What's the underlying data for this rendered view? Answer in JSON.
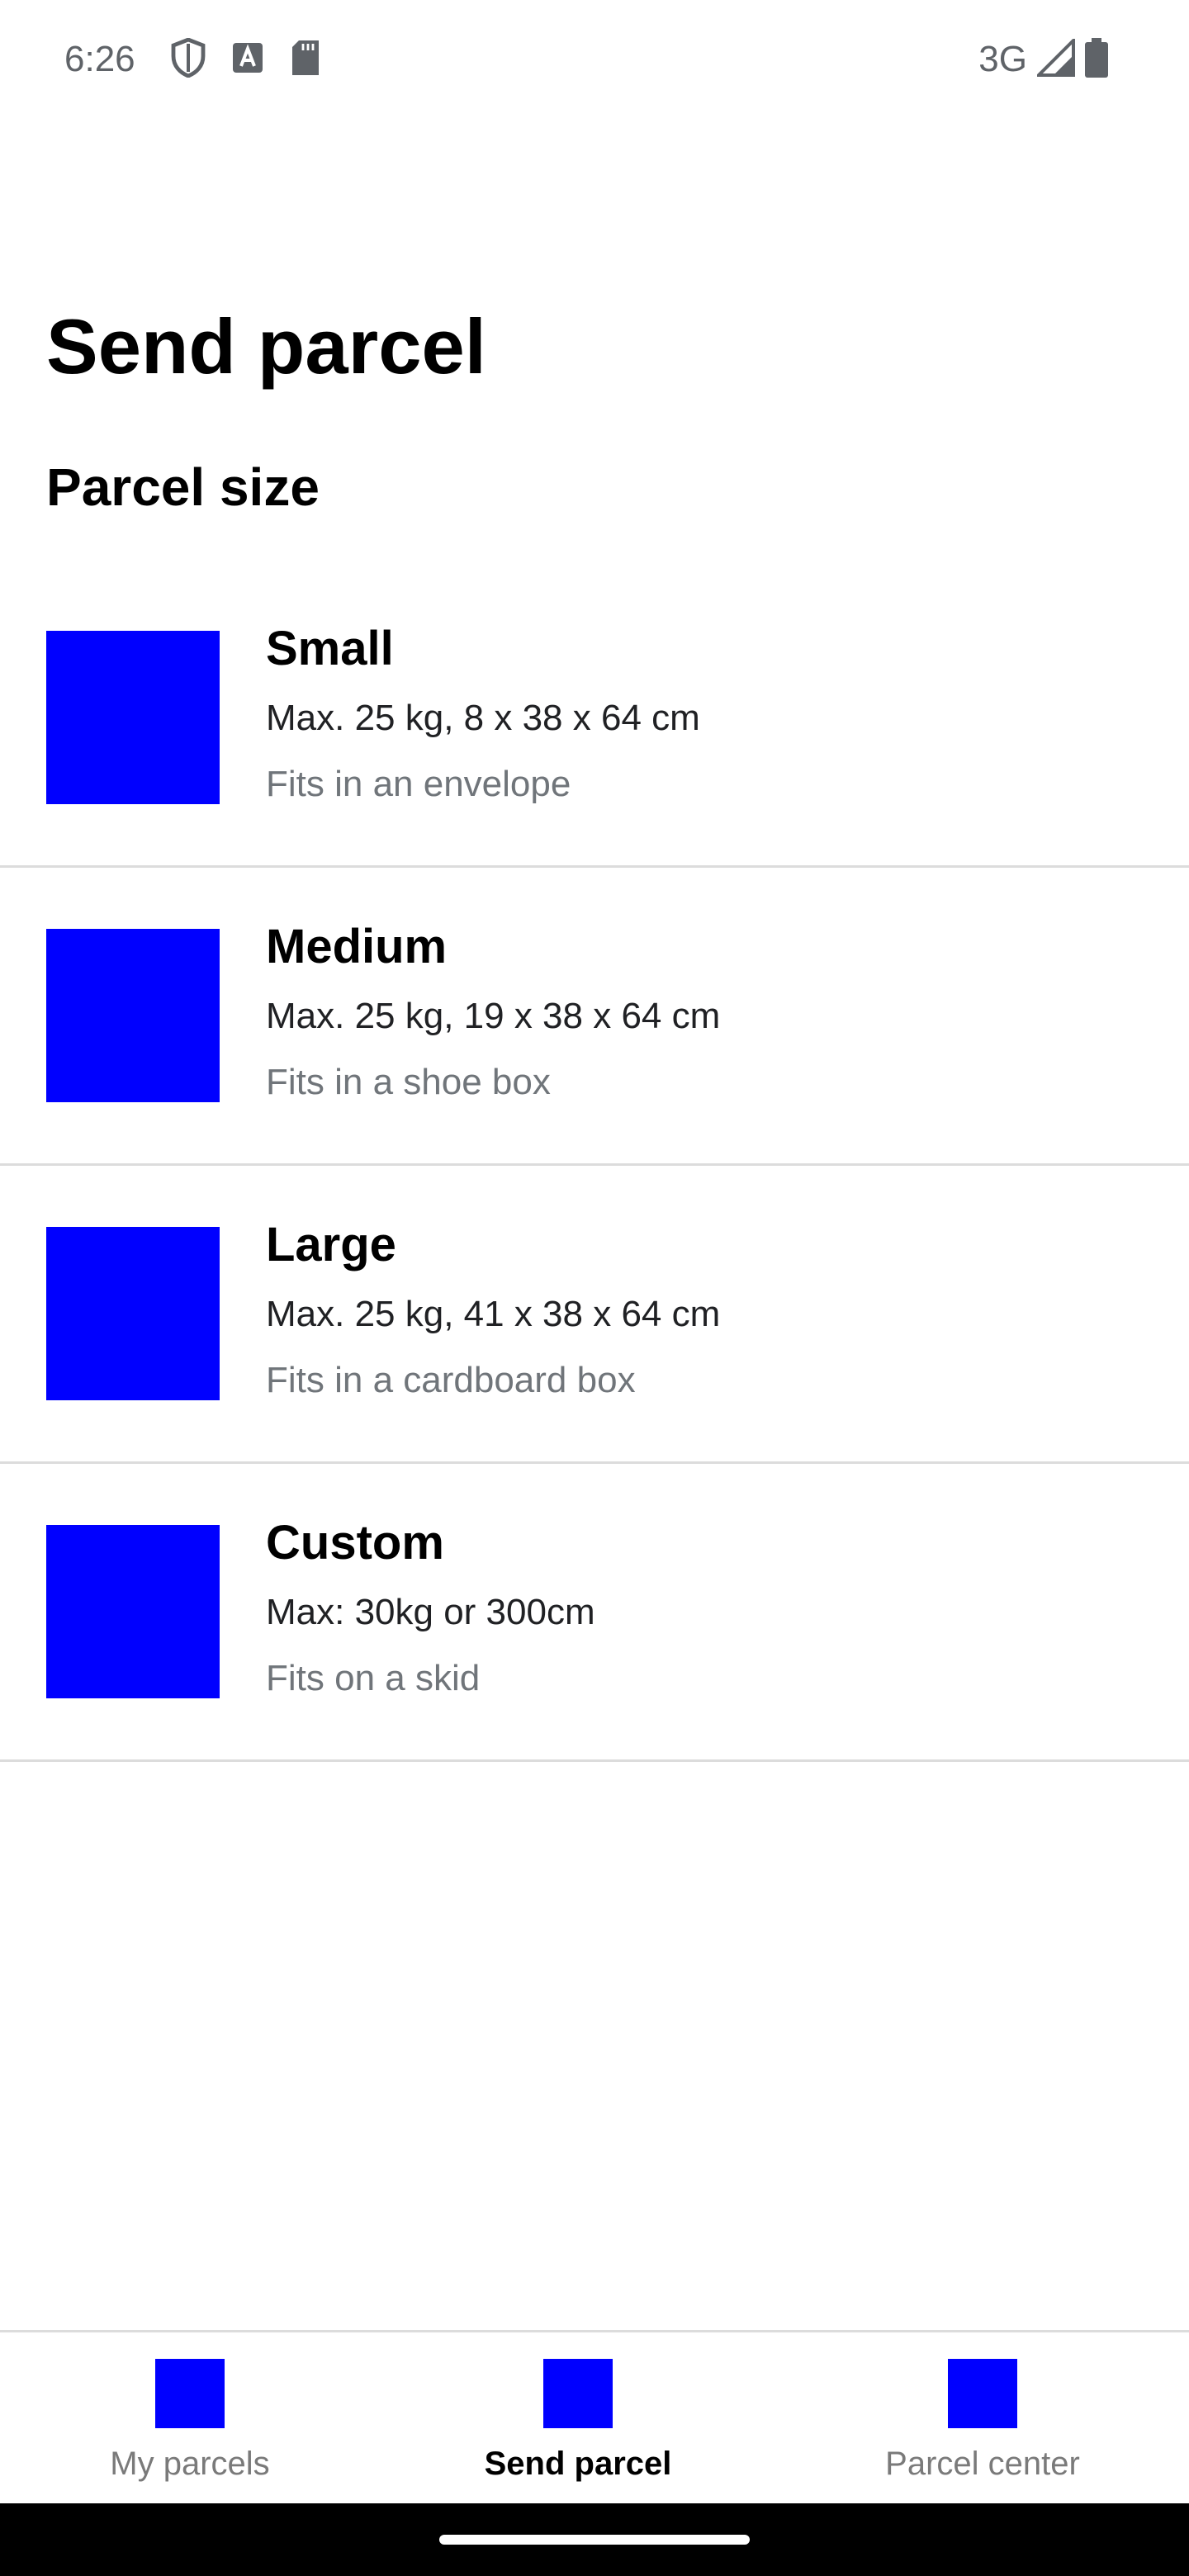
{
  "status_bar": {
    "time": "6:26",
    "network": "3G",
    "icons": [
      "shield-icon",
      "font-a-icon",
      "sd-card-icon",
      "signal-icon",
      "battery-icon"
    ]
  },
  "page": {
    "title": "Send parcel",
    "section_title": "Parcel size"
  },
  "colors": {
    "thumbnail": "#0000ff",
    "divider": "#dcdcdc",
    "secondary_text": "#70757a",
    "inactive_nav": "#7a7a7a"
  },
  "parcels": [
    {
      "name": "Small",
      "dims": "Max. 25 kg, 8 x 38 x 64 cm",
      "desc": "Fits in an envelope"
    },
    {
      "name": "Medium",
      "dims": "Max. 25 kg, 19 x 38 x 64 cm",
      "desc": "Fits in a shoe box"
    },
    {
      "name": "Large",
      "dims": "Max. 25 kg, 41 x 38 x 64 cm",
      "desc": "Fits in a cardboard box"
    },
    {
      "name": "Custom",
      "dims": "Max: 30kg or 300cm",
      "desc": "Fits on a skid"
    }
  ],
  "bottom_nav": {
    "items": [
      {
        "label": "My parcels",
        "active": false
      },
      {
        "label": "Send parcel",
        "active": true
      },
      {
        "label": "Parcel center",
        "active": false
      }
    ]
  }
}
